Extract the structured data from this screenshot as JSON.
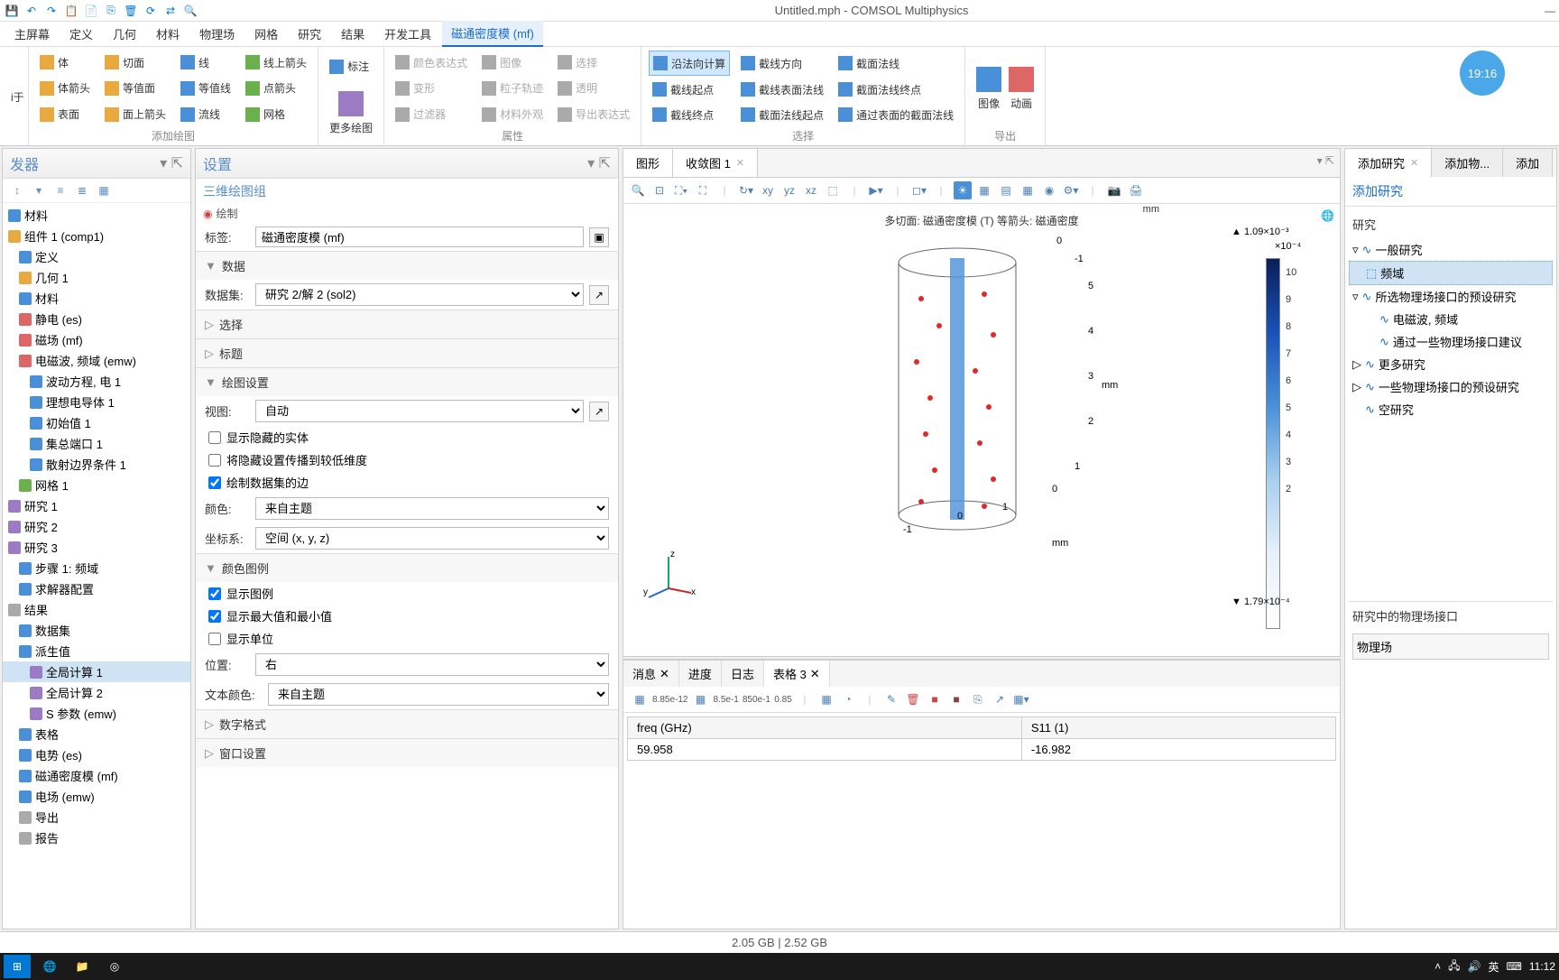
{
  "title": "Untitled.mph - COMSOL Multiphysics",
  "menu": {
    "m0": "主屏幕",
    "m1": "定义",
    "m2": "几何",
    "m3": "材料",
    "m4": "物理场",
    "m5": "网格",
    "m6": "研究",
    "m7": "结果",
    "m8": "开发工具",
    "m9": "磁通密度模 (mf)"
  },
  "ribbon": {
    "g1": {
      "r0": "体",
      "r1": "体箭头",
      "r2": "表面",
      "r3": "切面",
      "r4": "等值面",
      "r5": "面上箭头",
      "r6": "线",
      "r7": "等值线",
      "r8": "流线",
      "r9": "线上箭头",
      "r10": "点箭头",
      "r11": "网格",
      "r12": "标注",
      "label": "添加绘图"
    },
    "more": "更多绘图",
    "g2": {
      "r0": "颜色表达式",
      "r1": "变形",
      "r2": "过滤器",
      "r3": "图像",
      "r4": "选择",
      "r5": "材料外观",
      "r6": "透明",
      "r7": "导出表达式",
      "label": "属性"
    },
    "g3": {
      "r0": "沿法向计算",
      "r1": "截线起点",
      "r2": "截线终点",
      "r3": "截线方向",
      "r4": "截线表面法线",
      "r5": "截面法线起点",
      "r6": "截面法线",
      "r7": "截面法线终点",
      "r8": "通过表面的截面法线",
      "label": "选择"
    },
    "g4": {
      "r0": "图像",
      "r1": "动画",
      "label": "导出"
    }
  },
  "clock": "19:16",
  "builder": {
    "title": "发器",
    "nodes": {
      "n0": "材料",
      "n1": "组件 1 (comp1)",
      "n2": "定义",
      "n3": "几何 1",
      "n4": "材料",
      "n5": "静电 (es)",
      "n6": "磁场 (mf)",
      "n7": "电磁波, 频域 (emw)",
      "n8": "波动方程, 电 1",
      "n9": "理想电导体 1",
      "n10": "初始值 1",
      "n11": "集总端口 1",
      "n12": "散射边界条件 1",
      "n13": "网格 1",
      "n14": "研究 1",
      "n15": "研究 2",
      "n16": "研究 3",
      "n17": "步骤 1: 频域",
      "n18": "求解器配置",
      "n19": "结果",
      "n20": "数据集",
      "n21": "派生值",
      "n22": "全局计算 1",
      "n23": "全局计算 2",
      "n24": "S 参数 (emw)",
      "n25": "表格",
      "n26": "电势 (es)",
      "n27": "磁通密度模 (mf)",
      "n28": "电场 (emw)",
      "n29": "导出",
      "n30": "报告"
    }
  },
  "settings": {
    "title": "设置",
    "subtitle": "三维绘图组",
    "drawbtn": "绘制",
    "label_lbl": "标签:",
    "label_val": "磁通密度模 (mf)",
    "sec_data": "数据",
    "dataset_lbl": "数据集:",
    "dataset_val": "研究 2/解 2 (sol2)",
    "sec_select": "选择",
    "sec_title": "标题",
    "sec_plot": "绘图设置",
    "view_lbl": "视图:",
    "view_val": "自动",
    "chk1": "显示隐藏的实体",
    "chk2": "将隐藏设置传播到较低维度",
    "chk3": "绘制数据集的边",
    "color_lbl": "颜色:",
    "color_val": "来自主题",
    "coord_lbl": "坐标系:",
    "coord_val": "空间 (x, y, z)",
    "sec_legend": "颜色图例",
    "chk4": "显示图例",
    "chk5": "显示最大值和最小值",
    "chk6": "显示单位",
    "pos_lbl": "位置:",
    "pos_val": "右",
    "txtcol_lbl": "文本颜色:",
    "txtcol_val": "来自主题",
    "sec_num": "数字格式",
    "sec_win": "窗口设置"
  },
  "graphics": {
    "tabs": {
      "t0": "图形",
      "t1": "收敛图 1"
    },
    "plot_title": "多切面: 磁通密度模 (T)  等箭头: 磁通密度",
    "unit_top": "mm",
    "unit_right": "mm",
    "unit_bottom": "mm",
    "legend_max": "▲ 1.09×10⁻³",
    "legend_exp": "×10⁻⁴",
    "legend_min": "▼ 1.79×10⁻⁴",
    "ticks": {
      "t0": "10",
      "t1": "9",
      "t2": "8",
      "t3": "7",
      "t4": "6",
      "t5": "5",
      "t6": "4",
      "t7": "3",
      "t8": "2"
    },
    "axisvals": {
      "a0": "0",
      "a1": "-1",
      "a2": "5",
      "a3": "4",
      "a4": "3",
      "a5": "2",
      "a6": "1",
      "a7": "0",
      "a8": "-1",
      "a9": "0",
      "a10": "1"
    },
    "triad": {
      "x": "x",
      "y": "y",
      "z": "z"
    }
  },
  "bottom": {
    "tabs": {
      "t0": "消息",
      "t1": "进度",
      "t2": "日志",
      "t3": "表格 3"
    },
    "table": {
      "h0": "freq (GHz)",
      "h1": "S11 (1)",
      "c0": "59.958",
      "c1": "-16.982"
    },
    "toolvals": {
      "v0": "8.85e-12",
      "v1": "8.5e-1",
      "v2": "850e-1",
      "v3": "0.85"
    }
  },
  "right": {
    "tabs": {
      "t0": "添加研究",
      "t1": "添加物...",
      "t2": "添加"
    },
    "add": "添加研究",
    "h_study": "研究",
    "nodes": {
      "n0": "一般研究",
      "n1": "频域",
      "n2": "所选物理场接口的预设研究",
      "n3": "电磁波, 频域",
      "n4": "通过一些物理场接口建议",
      "n5": "更多研究",
      "n6": "一些物理场接口的预设研究",
      "n7": "空研究"
    },
    "h_phys": "研究中的物理场接口",
    "phys_lbl": "物理场"
  },
  "status": "2.05 GB | 2.52 GB",
  "taskbar": {
    "lang": "英",
    "time": "11:12"
  }
}
